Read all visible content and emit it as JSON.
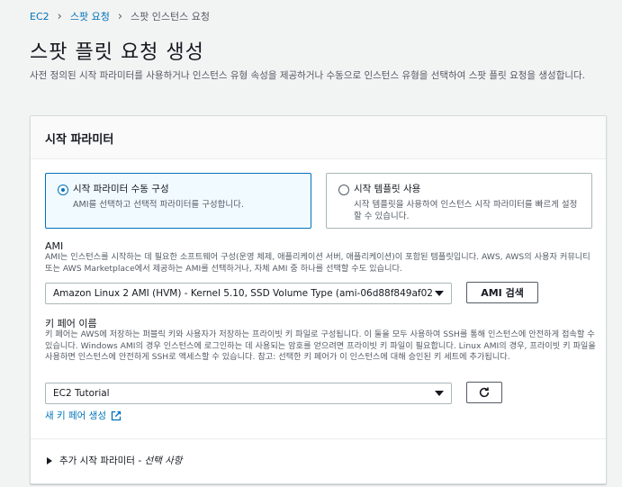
{
  "breadcrumb": {
    "items": [
      "EC2",
      "스팟 요청"
    ],
    "current": "스팟 인스턴스 요청"
  },
  "page": {
    "title": "스팟 플릿 요청 생성",
    "description": "사전 정의된 시작 파라미터를 사용하거나 인스턴스 유형 속성을 제공하거나 수동으로 인스턴스 유형을 선택하여 스팟 플릿 요청을 생성합니다."
  },
  "panel": {
    "title": "시작 파라미터",
    "options": [
      {
        "title": "시작 파라미터 수동 구성",
        "description": "AMI를 선택하고 선택적 파라미터를 구성합니다.",
        "selected": true
      },
      {
        "title": "시작 템플릿 사용",
        "description": "시작 템플릿을 사용하여 인스턴스 시작 파라미터를 빠르게 설정할 수 있습니다.",
        "selected": false
      }
    ],
    "ami": {
      "label": "AMI",
      "description": "AMI는 인스턴스를 시작하는 데 필요한 소프트웨어 구성(운영 체제, 애플리케이션 서버, 애플리케이션)이 포함된 템플릿입니다. AWS, AWS의 사용자 커뮤니티 또는 AWS Marketplace에서 제공하는 AMI를 선택하거나, 자체 AMI 중 하나를 선택할 수도 있습니다.",
      "value": "Amazon Linux 2 AMI (HVM) - Kernel 5.10, SSD Volume Type (ami-06d88f849af02",
      "search_button": "AMI 검색"
    },
    "key_pair": {
      "label": "키 페어 이름",
      "description": "키 페어는 AWS에 저장하는 퍼블릭 키와 사용자가 저장하는 프라이빗 키 파일로 구성됩니다. 이 둘을 모두 사용하여 SSH를 통해 인스턴스에 안전하게 접속할 수 있습니다. Windows AMI의 경우 인스턴스에 로그인하는 데 사용되는 암호를 얻으려면 프라이빗 키 파일이 필요합니다. Linux AMI의 경우, 프라이빗 키 파일을 사용하면 인스턴스에 안전하게 SSH로 액세스할 수 있습니다. 참고: 선택한 키 페어가 이 인스턴스에 대해 승인된 키 세트에 추가됩니다.",
      "value": "EC2 Tutorial",
      "create_link": "새 키 페어 생성"
    },
    "advanced": {
      "label": "추가 시작 파라미터",
      "optional": "- 선택 사항"
    }
  },
  "icons": {
    "separator": "chevron-right-icon",
    "refresh": "refresh-icon",
    "external": "external-link-icon"
  },
  "colors": {
    "link": "#0073bb",
    "selected_bg": "#f1faff",
    "border": "#aab7b8"
  }
}
